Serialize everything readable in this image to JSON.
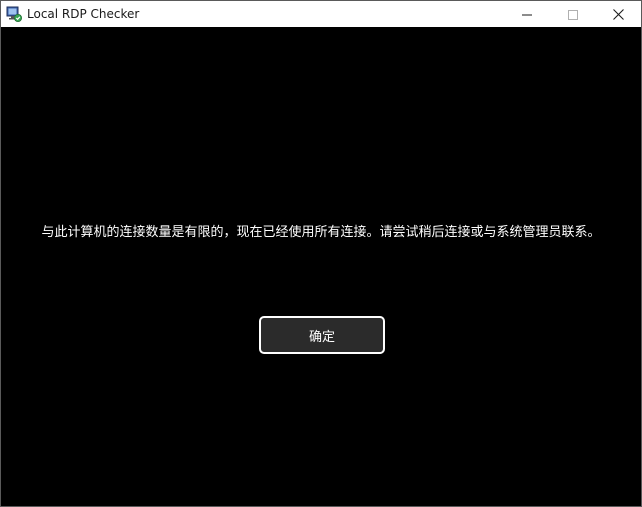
{
  "window": {
    "title": "Local RDP Checker",
    "icon": "rdp-monitor-icon",
    "controls": {
      "minimize_icon": "minimize-icon",
      "maximize_icon": "maximize-icon",
      "close_icon": "close-icon"
    }
  },
  "dialog": {
    "message": "与此计算机的连接数量是有限的，现在已经使用所有连接。请尝试稍后连接或与系统管理员联系。",
    "ok_label": "确定"
  },
  "colors": {
    "background": "#000000",
    "text": "#ffffff",
    "button_fill": "#2b2b2b",
    "button_border": "#ffffff",
    "titlebar": "#ffffff"
  }
}
